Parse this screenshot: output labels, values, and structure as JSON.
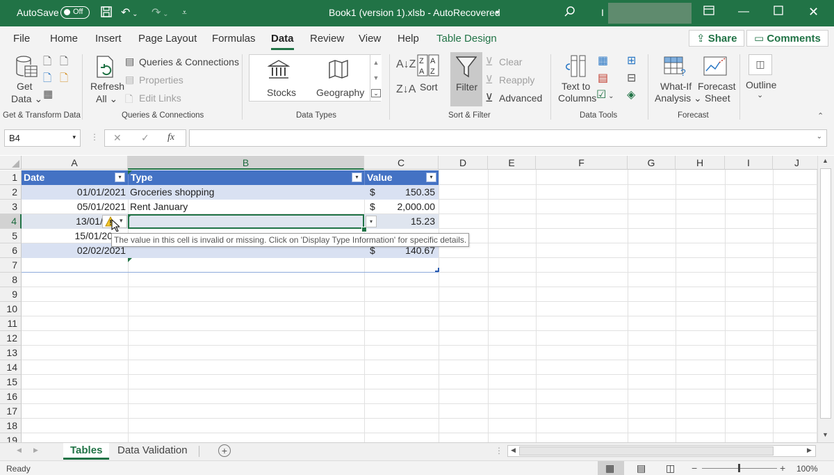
{
  "titlebar": {
    "autosave_label": "AutoSave",
    "autosave_state": "Off",
    "doc_title": "Book1 (version 1).xlsb  -  AutoRecovered",
    "user_initial": "I"
  },
  "ribbon_tabs": [
    "File",
    "Home",
    "Insert",
    "Page Layout",
    "Formulas",
    "Data",
    "Review",
    "View",
    "Help",
    "Table Design"
  ],
  "active_tab": "Data",
  "share_label": "Share",
  "comments_label": "Comments",
  "ribbon": {
    "get_data_line1": "Get",
    "get_data_line2": "Data",
    "refresh_line1": "Refresh",
    "refresh_line2": "All",
    "queries_connections": "Queries & Connections",
    "properties": "Properties",
    "edit_links": "Edit Links",
    "stocks": "Stocks",
    "geography": "Geography",
    "sort": "Sort",
    "filter": "Filter",
    "clear": "Clear",
    "reapply": "Reapply",
    "advanced": "Advanced",
    "text_to_columns_line1": "Text to",
    "text_to_columns_line2": "Columns",
    "what_if_line1": "What-If",
    "what_if_line2": "Analysis",
    "forecast_line1": "Forecast",
    "forecast_line2": "Sheet",
    "outline": "Outline",
    "groups": {
      "get_transform": "Get & Transform Data",
      "queries": "Queries & Connections",
      "data_types": "Data Types",
      "sort_filter": "Sort & Filter",
      "data_tools": "Data Tools",
      "forecast": "Forecast"
    }
  },
  "formula_bar": {
    "name_box": "B4",
    "fx": "fx",
    "value": ""
  },
  "columns": [
    "A",
    "B",
    "C",
    "D",
    "E",
    "F",
    "G",
    "H",
    "I",
    "J"
  ],
  "rows": [
    "1",
    "2",
    "3",
    "4",
    "5",
    "6",
    "7",
    "8",
    "9",
    "10",
    "11",
    "12",
    "13",
    "14",
    "15",
    "16",
    "17",
    "18",
    "19"
  ],
  "table": {
    "headers": [
      "Date",
      "Type",
      "Value"
    ],
    "rows": [
      {
        "date": "01/01/2021",
        "type": "Groceries shopping",
        "currency": "$",
        "value": "150.35"
      },
      {
        "date": "05/01/2021",
        "type": "Rent January",
        "currency": "$",
        "value": "2,000.00"
      },
      {
        "date": "13/01/",
        "type": "",
        "currency": "",
        "value": "15.23"
      },
      {
        "date": "15/01/20",
        "type": "",
        "currency": "",
        "value": ""
      },
      {
        "date": "02/02/2021",
        "type": "",
        "currency": "$",
        "value": "140.67"
      }
    ]
  },
  "tooltip": "The value in this cell is invalid or missing.  Click on 'Display Type Information' for specific details.",
  "sheets": [
    "Tables",
    "Data Validation"
  ],
  "active_sheet": "Tables",
  "status": {
    "ready": "Ready",
    "zoom": "100%"
  },
  "icons": {
    "save": "save-icon",
    "undo": "undo-icon",
    "redo": "redo-icon",
    "search": "search-icon",
    "minimize": "minimize-icon",
    "maximize": "maximize-icon",
    "close": "close-icon",
    "warning": "warning-icon"
  },
  "colors": {
    "excel_green": "#217346",
    "table_header": "#4472c4",
    "table_band": "#d9e1f2"
  }
}
